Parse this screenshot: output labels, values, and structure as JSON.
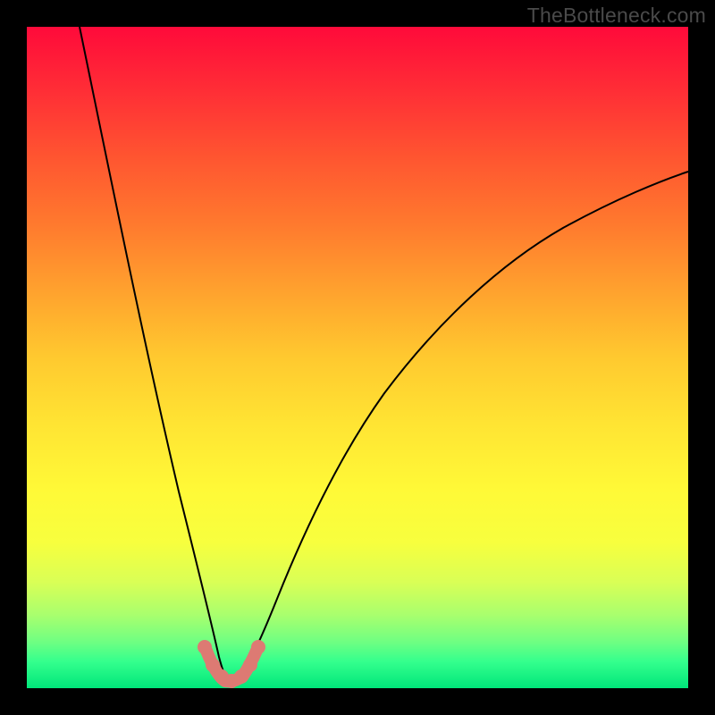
{
  "watermark": "TheBottleneck.com",
  "chart_data": {
    "type": "line",
    "title": "",
    "xlabel": "",
    "ylabel": "",
    "xlim": [
      0,
      100
    ],
    "ylim": [
      0,
      100
    ],
    "series": [
      {
        "name": "left-branch",
        "x": [
          8,
          10,
          12,
          14,
          16,
          18,
          20,
          22,
          24,
          25,
          26,
          27,
          28,
          29
        ],
        "y": [
          100,
          90,
          80,
          70,
          60,
          50,
          40,
          30,
          20,
          15,
          10,
          6,
          3,
          1.5
        ]
      },
      {
        "name": "right-branch",
        "x": [
          31,
          32,
          34,
          36,
          40,
          45,
          50,
          55,
          60,
          65,
          70,
          75,
          80,
          85,
          90,
          95,
          100
        ],
        "y": [
          1.5,
          3,
          7,
          12,
          22,
          33,
          42,
          49,
          55,
          60,
          64,
          67.5,
          70.5,
          73,
          75,
          77,
          78.5
        ]
      },
      {
        "name": "valley-markers",
        "x": [
          26.5,
          27.5,
          28.5,
          29.5,
          30,
          30.5,
          31.5,
          32.5,
          33.5
        ],
        "y": [
          6.5,
          4,
          2.2,
          1.2,
          1,
          1.2,
          2.2,
          4,
          6.5
        ]
      }
    ],
    "colors": {
      "curve": "#000000",
      "markers": "#dd7a73",
      "gradient_top": "#ff0a3a",
      "gradient_bottom": "#00e67a"
    }
  }
}
